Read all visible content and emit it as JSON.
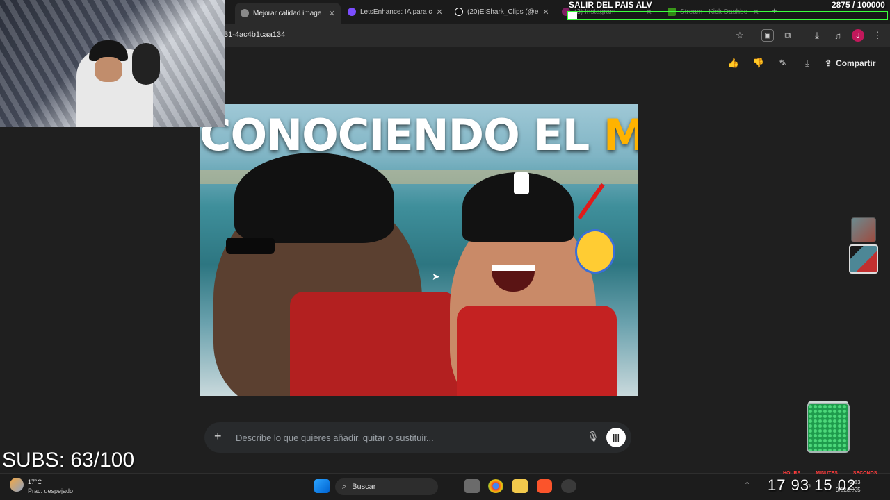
{
  "browser": {
    "tabs": [
      {
        "label": "Mejorar calidad image",
        "active": true,
        "icon": "generic-site-icon"
      },
      {
        "label": "LetsEnhance: IA para c",
        "active": false,
        "icon": "letsenhance-icon"
      },
      {
        "label": "(20)ElShark_Clips (@e",
        "active": false,
        "icon": "tiktok-icon"
      },
      {
        "label": "(3) Instagram",
        "active": false,
        "icon": "instagram-icon"
      },
      {
        "label": "Stream - Kick Dashbo",
        "active": false,
        "icon": "kick-icon"
      }
    ],
    "new_tab_label": "+",
    "url_fragment": "31-4ac4b1caa134",
    "profile_initial": "J"
  },
  "toolbar": {
    "share_label": "Compartir"
  },
  "thumbnail": {
    "title_part1": "CONOCIENDO EL ",
    "title_part2": "MAR"
  },
  "prompt": {
    "add_label": "+",
    "placeholder": "Describe lo que quieres añadir, quitar o sustituir..."
  },
  "taskbar": {
    "temperature": "17°C",
    "weather": "Prac. despejado",
    "search_label": "Buscar",
    "clock_time": "2:53",
    "clock_date": "9/12/2025"
  },
  "overlay": {
    "goal_title": "SALIR DEL PAIS ALV",
    "goal_progress": "2875 / 100000",
    "goal_fraction": 0.02875,
    "subs": "SUBS: 63/100",
    "timer_labels": [
      "HOURS",
      "MINUTES",
      "SECONDS"
    ],
    "timer": "17 93 15 02"
  },
  "colors": {
    "accent_yellow": "#ffb300",
    "progress_border": "#3cff3c",
    "timer_label": "#ff3b3b"
  }
}
